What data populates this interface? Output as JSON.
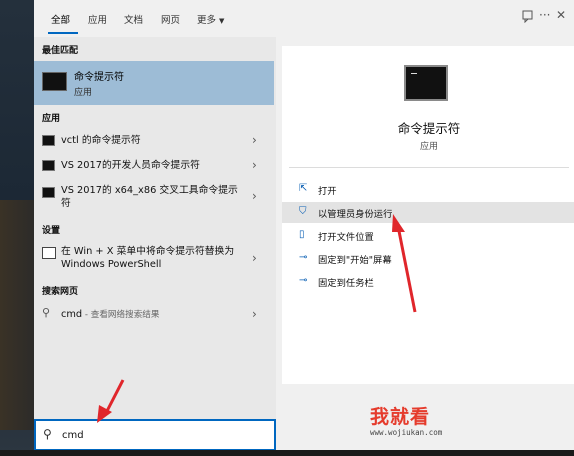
{
  "tabs": [
    "全部",
    "应用",
    "文档",
    "网页",
    "更多"
  ],
  "top_icons": [
    "feedback-icon",
    "more-options-icon",
    "close-icon"
  ],
  "best_match": {
    "section_label": "最佳匹配",
    "title": "命令提示符",
    "subtitle": "应用"
  },
  "apps": {
    "section_label": "应用",
    "items": [
      {
        "label": "vctl 的命令提示符"
      },
      {
        "label": "VS 2017的开发人员命令提示符"
      },
      {
        "label": "VS 2017的 x64_x86 交叉工具命令提示符"
      }
    ]
  },
  "settings": {
    "section_label": "设置",
    "items": [
      {
        "label": "在 Win + X 菜单中将命令提示符替换为 Windows PowerShell"
      }
    ]
  },
  "web": {
    "section_label": "搜索网页",
    "query": "cmd",
    "suffix": " - 查看网络搜索结果"
  },
  "detail": {
    "title": "命令提示符",
    "subtitle": "应用",
    "actions": [
      {
        "label": "打开",
        "icon": "open-icon"
      },
      {
        "label": "以管理员身份运行",
        "icon": "shield-icon",
        "highlighted": true
      },
      {
        "label": "打开文件位置",
        "icon": "file-location-icon"
      },
      {
        "label": "固定到\"开始\"屏幕",
        "icon": "pin-icon"
      },
      {
        "label": "固定到任务栏",
        "icon": "pin-icon"
      }
    ]
  },
  "search": {
    "value": "cmd"
  },
  "watermark": {
    "main": "我就看",
    "url": "www.wojiukan.com"
  },
  "colors": {
    "accent": "#0067c0",
    "selection": "#9dbcd6",
    "annotation_arrow": "#e0262b"
  }
}
